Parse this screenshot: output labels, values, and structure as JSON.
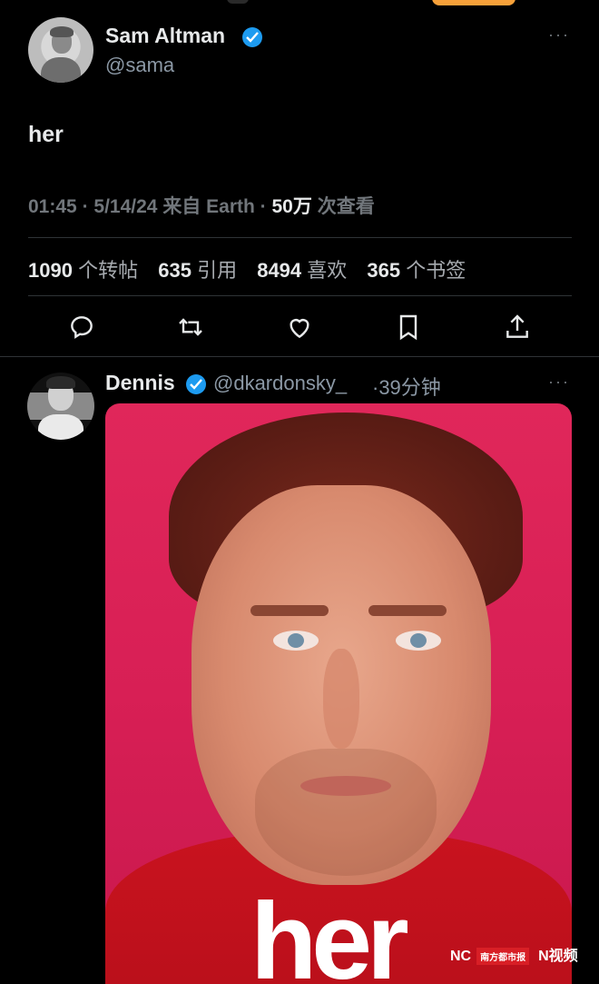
{
  "tweet": {
    "author_name": "Sam Altman",
    "author_handle": "@sama",
    "text": "her",
    "time": "01:45",
    "date": "5/14/24",
    "source_prefix": "来自 Earth",
    "views_count": "50万",
    "views_label": "次查看",
    "stats": [
      {
        "num": "1090",
        "label": "个转帖"
      },
      {
        "num": "635",
        "label": "引用"
      },
      {
        "num": "8494",
        "label": "喜欢"
      },
      {
        "num": "365",
        "label": "个书签"
      }
    ],
    "more_glyph": "···",
    "actions": [
      "reply-icon",
      "retweet-icon",
      "like-icon",
      "bookmark-icon",
      "share-icon"
    ]
  },
  "reply": {
    "author_name": "Dennis",
    "author_handle": "@dkardonsky_",
    "time": "·39分钟",
    "more_glyph": "···",
    "media_text": "her"
  },
  "watermark": {
    "left": "NC",
    "badge": "南方都市报",
    "right": "N视频"
  },
  "colors": {
    "background": "#000000",
    "verified": "#1d9bf0",
    "poster_bg": "#d81f55"
  }
}
